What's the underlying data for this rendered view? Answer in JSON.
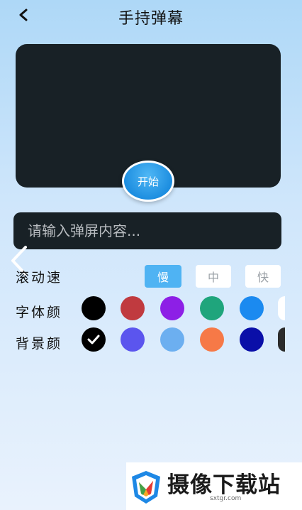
{
  "header": {
    "title": "手持弹幕",
    "back_icon": "chevron-left-icon"
  },
  "preview": {
    "start_label": "开始"
  },
  "input": {
    "placeholder": "请输入弹屏内容..."
  },
  "speed": {
    "label": "滚动速",
    "options": [
      "慢",
      "中",
      "快"
    ],
    "selected": "慢"
  },
  "font_color": {
    "label": "字体颜",
    "colors": [
      "#000000",
      "#c03a3f",
      "#8d1fe6",
      "#1fa57c",
      "#1b8af0",
      "#ffffff"
    ]
  },
  "bg_color": {
    "label": "背景颜",
    "colors": [
      "#000000",
      "#5b55ee",
      "#6caff0",
      "#f67947",
      "#0a0fa8",
      "#2b2b2b"
    ],
    "selected_index": 0
  },
  "watermark": {
    "text": "摄像下载站",
    "url": "sxtgr.com"
  }
}
